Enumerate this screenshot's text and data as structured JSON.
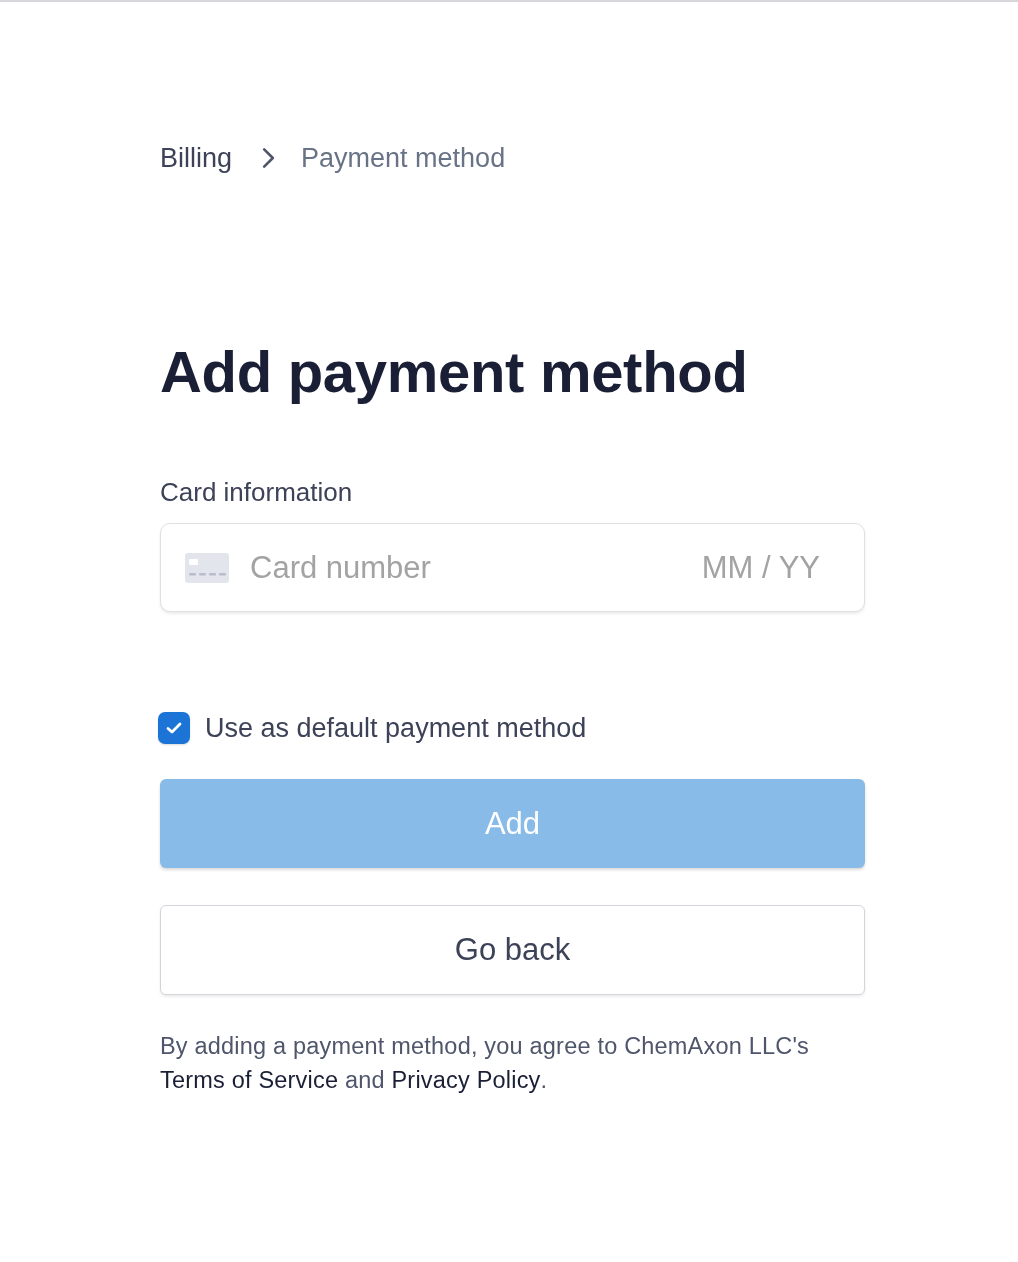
{
  "breadcrumb": [
    {
      "label": "Billing",
      "selected": false
    },
    {
      "label": "Payment method",
      "selected": true
    }
  ],
  "title": "Add payment method",
  "card_information": {
    "label": "Card information",
    "card_number": {
      "placeholder": "Card number"
    },
    "expiry": {
      "placeholder": "MM / YY"
    }
  },
  "default_checkbox": {
    "label": "Use as default payment method",
    "checked": true
  },
  "buttons": [
    {
      "kind": "primary",
      "label": "Add",
      "disabled": true
    },
    {
      "kind": "secondary",
      "label": "Go back",
      "disabled": false
    }
  ],
  "terms": [
    {
      "kind": "text",
      "text": "By adding a payment method, you agree to ChemAxon LLC's "
    },
    {
      "kind": "link",
      "text": "Terms of Service"
    },
    {
      "kind": "text",
      "text": " and "
    },
    {
      "kind": "link",
      "text": "Privacy Policy"
    },
    {
      "kind": "text",
      "text": "."
    }
  ]
}
